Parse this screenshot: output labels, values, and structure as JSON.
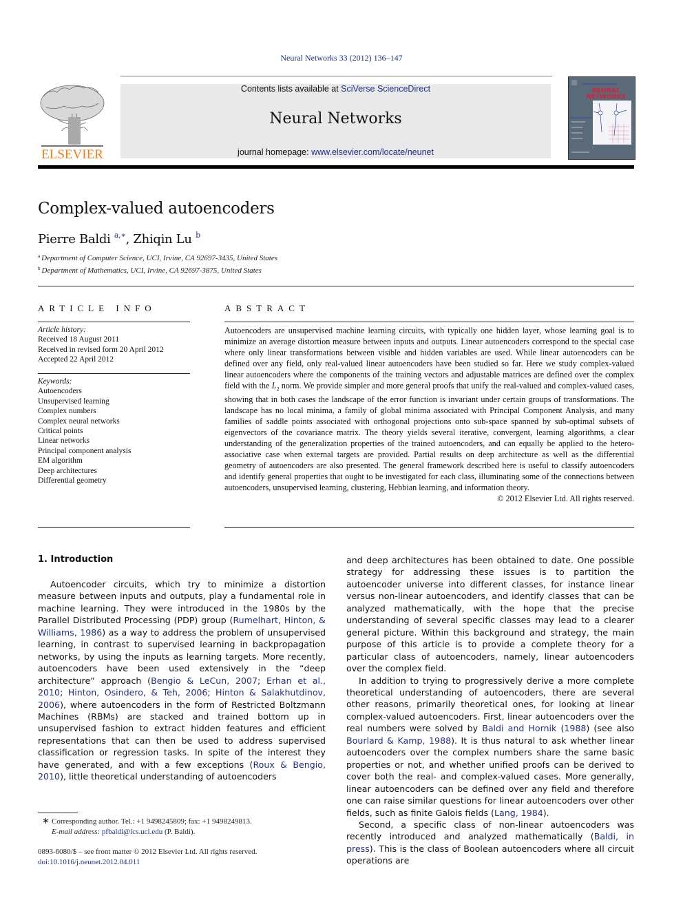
{
  "header": {
    "citation": "Neural Networks 33 (2012) 136–147",
    "publisher_logo": "ELSEVIER",
    "contents_prefix": "Contents lists available at ",
    "contents_link": "SciVerse ScienceDirect",
    "journal_name": "Neural Networks",
    "homepage_prefix": "journal homepage: ",
    "homepage_link": "www.elsevier.com/locate/neunet",
    "cover_title_line1": "NEURAL",
    "cover_title_line2": "NETWORKS",
    "colors": {
      "link": "#1f2f8a",
      "elsevier_orange": "#f07f1b",
      "banner_bg": "#e9e9e9",
      "cover_bg": "#5b6a78",
      "cover_title": "#d8203a"
    }
  },
  "article": {
    "title": "Complex-valued autoencoders",
    "authors": [
      {
        "name": "Pierre Baldi",
        "marks": "a,∗"
      },
      {
        "name": "Zhiqin Lu",
        "marks": "b"
      }
    ],
    "author_separator": ", ",
    "affiliations": [
      {
        "mark": "a",
        "text": "Department of Computer Science, UCI, Irvine, CA 92697-3435, United States"
      },
      {
        "mark": "b",
        "text": "Department of Mathematics, UCI, Irvine, CA 92697-3875, United States"
      }
    ]
  },
  "article_info": {
    "heading": "ARTICLE INFO",
    "history_label": "Article history:",
    "history": [
      "Received 18 August 2011",
      "Received in revised form 20 April 2012",
      "Accepted 22 April 2012"
    ],
    "keywords_label": "Keywords:",
    "keywords": [
      "Autoencoders",
      "Unsupervised learning",
      "Complex numbers",
      "Complex neural networks",
      "Critical points",
      "Linear networks",
      "Principal component analysis",
      "EM algorithm",
      "Deep architectures",
      "Differential geometry"
    ]
  },
  "abstract": {
    "heading": "ABSTRACT",
    "text_before_norm": "Autoencoders are unsupervised machine learning circuits, with typically one hidden layer, whose learning goal is to minimize an average distortion measure between inputs and outputs. Linear autoencoders correspond to the special case where only linear transformations between visible and hidden variables are used. While linear autoencoders can be defined over any field, only real-valued linear autoencoders have been studied so far. Here we study complex-valued linear autoencoders where the components of the training vectors and adjustable matrices are defined over the complex field with the ",
    "norm_symbol": "L",
    "norm_subscript": "2",
    "text_after_norm": " norm. We provide simpler and more general proofs that unify the real-valued and complex-valued cases, showing that in both cases the landscape of the error function is invariant under certain groups of transformations. The landscape has no local minima, a family of global minima associated with Principal Component Analysis, and many families of saddle points associated with orthogonal projections onto sub-space spanned by sub-optimal subsets of eigenvectors of the covariance matrix. The theory yields several iterative, convergent, learning algorithms, a clear understanding of the generalization properties of the trained autoencoders, and can equally be applied to the hetero-associative case when external targets are provided. Partial results on deep architecture as well as the differential geometry of autoencoders are also presented. The general framework described here is useful to classify autoencoders and identify general properties that ought to be investigated for each class, illuminating some of the connections between autoencoders, unsupervised learning, clustering, Hebbian learning, and information theory.",
    "copyright": "© 2012 Elsevier Ltd. All rights reserved."
  },
  "introduction": {
    "heading": "1.  Introduction",
    "left_col": {
      "p1_a": "Autoencoder circuits, which try to minimize a distortion measure between inputs and outputs, play a fundamental role in machine learning. They were introduced in the 1980s by the Parallel Distributed Processing (PDP) group (",
      "ref_rumelhart": "Rumelhart, Hinton, & Williams, 1986",
      "p1_b": ") as a way to address the problem of unsupervised learning, in contrast to supervised learning in backpropagation networks, by using the inputs as learning targets. More recently, autoencoders have been used extensively in the “deep architecture” approach (",
      "ref_bengio_lecun": "Bengio & LeCun, 2007",
      "sep1": "; ",
      "ref_erhan": "Erhan et al., 2010",
      "sep2": "; ",
      "ref_hinton_osindero": "Hinton, Osindero, & Teh, 2006",
      "sep3": "; ",
      "ref_hinton_salak": "Hinton & Salakhutdinov, 2006",
      "p1_c": "), where autoencoders in the form of Restricted Boltzmann Machines (RBMs) are stacked and trained bottom up in unsupervised fashion to extract hidden features and efficient representations that can then be used to address supervised classification or regression tasks. In spite of the interest they have generated, and with a few exceptions (",
      "ref_roux": "Roux & Bengio, 2010",
      "p1_d": "), little theoretical understanding of autoencoders"
    },
    "right_col": {
      "p1_cont": "and deep architectures has been obtained to date. One possible strategy for addressing these issues is to partition the autoencoder universe into different classes, for instance linear versus non-linear autoencoders, and identify classes that can be analyzed mathematically, with the hope that the precise understanding of several specific classes may lead to a clearer general picture. Within this background and strategy, the main purpose of this article is to provide a complete theory for a particular class of autoencoders, namely, linear autoencoders over the complex field.",
      "p2_a": "In addition to trying to progressively derive a more complete theoretical understanding of autoencoders, there are several other reasons, primarily theoretical ones, for looking at linear complex-valued autoencoders. First, linear autoencoders over the real numbers were solved by ",
      "ref_baldi_hornik": "Baldi and Hornik",
      "p2_b": " (",
      "ref_baldi_hornik_year": "1988",
      "p2_c": ") (see also ",
      "ref_bourlard": "Bourlard & Kamp, 1988",
      "p2_d": "). It is thus natural to ask whether linear autoencoders over the complex numbers share the same basic properties or not, and whether unified proofs can be derived to cover both the real- and complex-valued cases. More generally, linear autoencoders can be defined over any field and therefore one can raise similar questions for linear autoencoders over other fields, such as finite Galois fields (",
      "ref_lang": "Lang, 1984",
      "p2_e": ").",
      "p3_a": "Second, a specific class of non-linear autoencoders was recently introduced and analyzed mathematically (",
      "ref_baldi_press": "Baldi, in press",
      "p3_b": "). This is the class of Boolean autoencoders where all circuit operations are"
    }
  },
  "footnotes": {
    "star": "∗",
    "corresponding": "Corresponding author. Tel.: +1 9498245809; fax: +1 9498249813.",
    "email_label": "E-mail address:",
    "email": "pfbaldi@ics.uci.edu",
    "email_suffix": " (P. Baldi).",
    "front_matter": "0893-6080/$ – see front matter © 2012 Elsevier Ltd. All rights reserved.",
    "doi": "doi:10.1016/j.neunet.2012.04.011"
  }
}
